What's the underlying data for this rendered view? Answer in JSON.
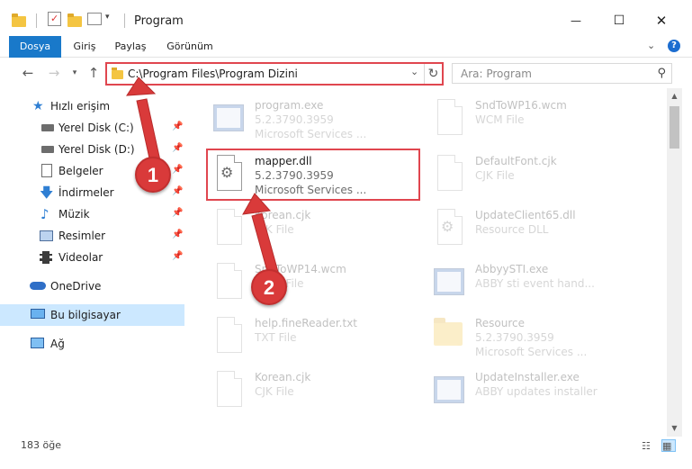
{
  "window": {
    "title": "Program",
    "minimize_glyph": "—",
    "maximize_glyph": "☐",
    "close_glyph": "✕"
  },
  "ribbon": {
    "tabs": [
      "Dosya",
      "Giriş",
      "Paylaş",
      "Görünüm"
    ],
    "active_tab_color": "#1979ca"
  },
  "navigation": {
    "address": "C:\\Program Files\\Program Dizini",
    "search_placeholder": "Ara: Program"
  },
  "sidebar": {
    "items": [
      {
        "label": "Hızlı erişim",
        "icon": "star-icon",
        "pinned": false
      },
      {
        "label": "Yerel Disk (C:)",
        "icon": "drive-icon",
        "pinned": true
      },
      {
        "label": "Yerel Disk (D:)",
        "icon": "drive-icon",
        "pinned": true
      },
      {
        "label": "Belgeler",
        "icon": "documents-icon",
        "pinned": true
      },
      {
        "label": "İndirmeler",
        "icon": "download-icon",
        "pinned": true
      },
      {
        "label": "Müzik",
        "icon": "music-icon",
        "pinned": true
      },
      {
        "label": "Resimler",
        "icon": "pictures-icon",
        "pinned": true
      },
      {
        "label": "Videolar",
        "icon": "videos-icon",
        "pinned": true
      },
      {
        "label": "OneDrive",
        "icon": "onedrive-icon",
        "pinned": false
      },
      {
        "label": "Bu bilgisayar",
        "icon": "computer-icon",
        "pinned": false,
        "selected": true
      },
      {
        "label": "Ağ",
        "icon": "network-icon",
        "pinned": false
      }
    ]
  },
  "files": {
    "left": [
      {
        "name": "program.exe",
        "line1": "5.2.3790.3959",
        "line2": "Microsoft Services ...",
        "icon": "exe-icon"
      },
      {
        "name": "mapper.dll",
        "line1": "5.2.3790.3959",
        "line2": "Microsoft Services ...",
        "icon": "dll-icon",
        "highlighted": true
      },
      {
        "name": "Korean.cjk",
        "line1": "CJK File",
        "line2": "",
        "icon": "file-icon"
      },
      {
        "name": "SndToWP14.wcm",
        "line1": "WCM File",
        "line2": "",
        "icon": "file-icon"
      },
      {
        "name": "help.fineReader.txt",
        "line1": "TXT File",
        "line2": "",
        "icon": "file-icon"
      },
      {
        "name": "Korean.cjk",
        "line1": "CJK File",
        "line2": "",
        "icon": "file-icon"
      }
    ],
    "right": [
      {
        "name": "SndToWP16.wcm",
        "line1": "WCM File",
        "line2": "",
        "icon": "file-icon"
      },
      {
        "name": "DefaultFont.cjk",
        "line1": "CJK File",
        "line2": "",
        "icon": "file-icon"
      },
      {
        "name": "UpdateClient65.dll",
        "line1": "Resource DLL",
        "line2": "",
        "icon": "dll-icon"
      },
      {
        "name": "AbbyySTI.exe",
        "line1": "ABBY sti event hand...",
        "line2": "",
        "icon": "app-icon"
      },
      {
        "name": "Resource",
        "line1": "5.2.3790.3959",
        "line2": "Microsoft Services ...",
        "icon": "folder-icon"
      },
      {
        "name": "UpdateInstaller.exe",
        "line1": "ABBY updates installer",
        "line2": "",
        "icon": "app-icon"
      }
    ]
  },
  "status": {
    "item_count": "183 öğe"
  },
  "annotations": {
    "marker_1": "1",
    "marker_2": "2",
    "marker_color": "#d93a3a"
  }
}
